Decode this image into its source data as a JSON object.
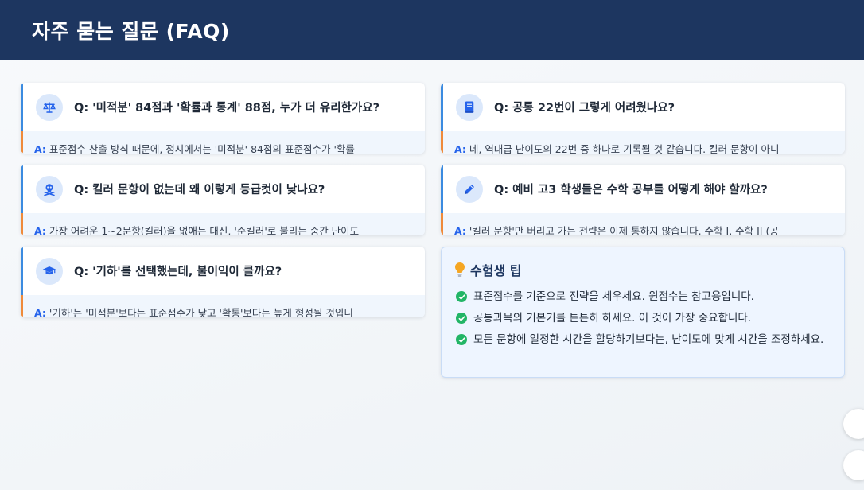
{
  "header": {
    "title": "자주 묻는 질문 (FAQ)"
  },
  "faq": [
    {
      "icon": "scale-icon",
      "question": "Q: '미적분' 84점과 '확률과 통계' 88점, 누가 더 유리한가요?",
      "answer_label": "A:",
      "answer": "표준점수 산출 방식 때문에, 정시에서는 '미적분' 84점의 표준점수가 '확률"
    },
    {
      "icon": "book-icon",
      "question": "Q: 공통 22번이 그렇게 어려웠나요?",
      "answer_label": "A:",
      "answer": "네, 역대급 난이도의 22번 중 하나로 기록될 것 같습니다. 킬러 문항이 아니"
    },
    {
      "icon": "skull-crossbones-icon",
      "question": "Q: 킬러 문항이 없는데 왜 이렇게 등급컷이 낮나요?",
      "answer_label": "A:",
      "answer": "가장 어려운 1~2문항(킬러)을 없애는 대신, '준킬러'로 불리는 중간 난이도"
    },
    {
      "icon": "pencil-icon",
      "question": "Q: 예비 고3 학생들은 수학 공부를 어떻게 해야 할까요?",
      "answer_label": "A:",
      "answer": "'킬러 문항'만 버리고 가는 전략은 이제 통하지 않습니다. 수학 I, 수학 II (공"
    },
    {
      "icon": "graduation-cap-icon",
      "question": "Q: '기하'를 선택했는데, 불이익이 클까요?",
      "answer_label": "A:",
      "answer": "'기하'는 '미적분'보다는 표준점수가 낮고 '확통'보다는 높게 형성될 것입니"
    }
  ],
  "tips": {
    "icon": "lightbulb-icon",
    "title": "수험생 팁",
    "items": [
      "표준점수를 기준으로 전략을 세우세요. 원점수는 참고용입니다.",
      "공통과목의 기본기를 튼튼히 하세요. 이 것이 가장 중요합니다.",
      "모든 문항에 일정한 시간을 할당하기보다는, 난이도에 맞게 시간을 조정하세요."
    ]
  },
  "colors": {
    "header_bg": "#1d3660",
    "accent_blue": "#3b8be0",
    "accent_orange": "#ef8a3a",
    "check_green": "#22b566"
  }
}
